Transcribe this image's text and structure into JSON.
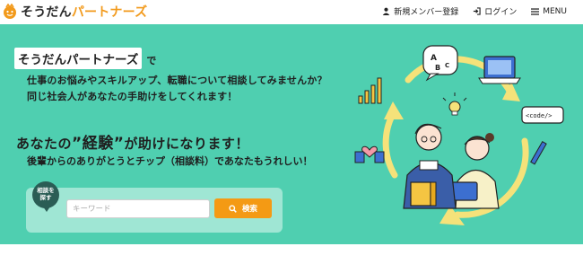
{
  "header": {
    "logo_part1": "そうだん",
    "logo_part2": "パートナーズ",
    "nav": {
      "register": "新規メンバー登録",
      "login": "ログイン",
      "menu": "MENU"
    }
  },
  "hero": {
    "brand": "そうだんパートナーズ",
    "brand_suffix": "で",
    "line1": "仕事のお悩みやスキルアップ、転職について相談してみませんか？",
    "line2": "同じ社会人があなたの手助けをしてくれます！",
    "headline_pre": "あなたの",
    "headline_q1": "”",
    "headline_key": "経験",
    "headline_q2": "”",
    "headline_post": "が助けになります！",
    "subline": "後輩からのありがとうとチップ（相談料）であなたもうれしい！",
    "illustration_code": "<code/>",
    "illustration_letters": [
      "A",
      "B",
      "C"
    ]
  },
  "search": {
    "bubble_line1": "相談を",
    "bubble_line2": "探す",
    "placeholder": "キーワード",
    "value": "",
    "button_label": "検索"
  },
  "colors": {
    "hero_bg": "#4fcfb0",
    "accent_orange": "#f49a14",
    "ring_yellow": "#f5e27a",
    "dark_teal": "#2a5d55"
  }
}
